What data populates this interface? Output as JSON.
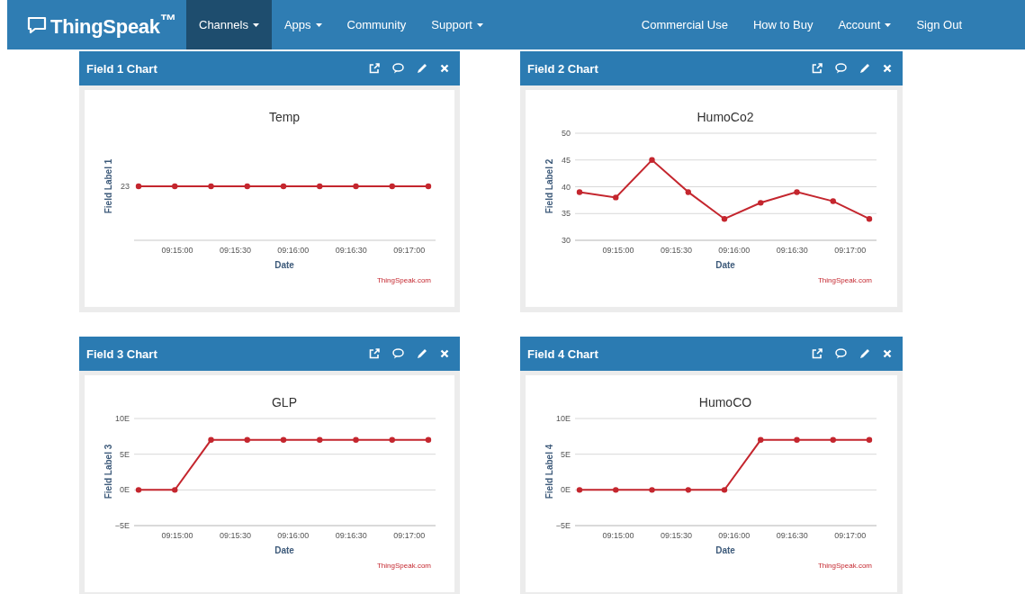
{
  "navbar": {
    "logo": "ThingSpeak$^{™}$",
    "left_items": [
      {
        "label": "Channels",
        "dropdown": true,
        "selected": true
      },
      {
        "label": "Apps",
        "dropdown": true,
        "selected": false
      },
      {
        "label": "Community",
        "dropdown": false,
        "selected": false
      },
      {
        "label": "Support",
        "dropdown": true,
        "selected": false
      }
    ],
    "right_items": [
      {
        "label": "Commercial Use",
        "dropdown": false,
        "selected": false
      },
      {
        "label": "How to Buy",
        "dropdown": false,
        "selected": false
      },
      {
        "label": "Account",
        "dropdown": true,
        "selected": false
      },
      {
        "label": "Sign Out",
        "dropdown": false,
        "selected": false
      }
    ]
  },
  "cards": [
    {
      "title": "Field 1 Chart",
      "credit": "ThingSpeak.com",
      "time_labels": [
        "09:15:00",
        "09:15:30",
        "09:16:00",
        "09:16:30",
        "09:17:00"
      ],
      "chart": {
        "title": "Temp",
        "xlabel": "Date",
        "ylabel": "Field Label 1",
        "y_label": "23"
      }
    },
    {
      "title": "Field 2 Chart",
      "credit": "ThingSpeak.com",
      "time_labels": [
        "09:15:00",
        "09:15:30",
        "09:16:00",
        "09:16:30",
        "09:17:00"
      ],
      "chart_data": {
        "type": "line",
        "title": "HumoCo2",
        "xlabel": "Date",
        "ylabel": "Field Label 2",
        "grid": true,
        "categories": [
          null,
          null,
          null,
          null,
          null,
          null,
          null,
          null,
          null
        ],
        "ylim": [
          30,
          50
        ],
        "yticks": [
          30,
          35,
          40,
          45,
          50
        ],
        "series": [
          {
            "color": "#c4262e",
            "marker": "o",
            "values": [
              39,
              38,
              45,
              39,
              34,
              37,
              39,
              37.3,
              34
            ]
          }
        ]
      }
    },
    {
      "title": "Field 3 Chart",
      "credit": "ThingSpeak.com",
      "time_labels": [
        "09:15:00",
        "09:15:30",
        "09:16:00",
        "09:16:30",
        "09:17:00"
      ],
      "chart_data": {
        "type": "line",
        "title": "GLP",
        "xlabel": "Date",
        "ylabel": "Field Label 3",
        "grid": true,
        "categories": [
          null,
          null,
          null,
          null,
          null,
          null,
          null,
          null,
          null
        ],
        "ylim": [
          -5,
          10
        ],
        "yticks": [
          {
            "value": -5,
            "label": "−5E"
          },
          {
            "value": 0,
            "label": "0E"
          },
          {
            "value": 5,
            "label": "5E"
          },
          {
            "value": 10,
            "label": "10E"
          }
        ],
        "series": [
          {
            "color": "#c4262e",
            "marker": "o",
            "values": [
              0,
              0,
              7,
              7,
              7,
              7,
              7,
              7,
              7
            ]
          }
        ]
      }
    },
    {
      "title": "Field 4 Chart",
      "credit": "ThingSpeak.com",
      "time_labels": [
        "09:15:00",
        "09:15:30",
        "09:16:00",
        "09:16:30",
        "09:17:00"
      ],
      "chart_data": {
        "type": "line",
        "title": "HumoCO",
        "xlabel": "Date",
        "ylabel": "Field Label 4",
        "grid": true,
        "categories": [
          null,
          null,
          null,
          null,
          null,
          null,
          null,
          null,
          null
        ],
        "ylim": [
          -5,
          10
        ],
        "yticks": [
          {
            "value": -5,
            "label": "−5E"
          },
          {
            "value": 0,
            "label": "0E"
          },
          {
            "value": 5,
            "label": "5E"
          },
          {
            "value": 10,
            "label": "10E"
          }
        ],
        "series": [
          {
            "color": "#c4262e",
            "marker": "o",
            "values": [
              0,
              0,
              0,
              0,
              0,
              7,
              7,
              7,
              7
            ]
          }
        ]
      }
    }
  ]
}
